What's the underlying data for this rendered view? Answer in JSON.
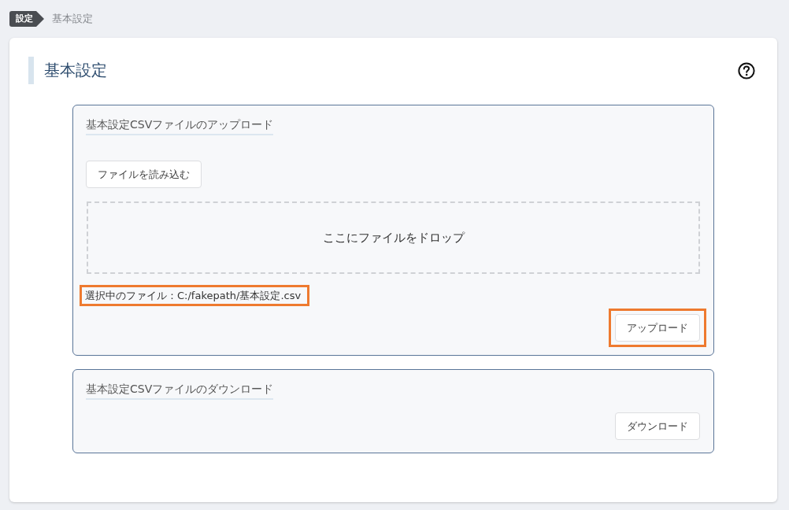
{
  "breadcrumb": [
    {
      "label": "設定",
      "kind": "tag"
    },
    {
      "label": "基本設定",
      "kind": "text"
    }
  ],
  "page": {
    "title": "基本設定"
  },
  "sections": [
    {
      "kind": "upload",
      "title": "基本設定CSVファイルのアップロード",
      "load_button": "ファイルを読み込む",
      "dropzone": "ここにファイルをドロップ",
      "selected_file": {
        "text": "選択中のファイル：C:/fakepath/基本設定.csv",
        "highlighted": true
      },
      "action": {
        "label": "アップロード",
        "highlighted": true
      }
    },
    {
      "kind": "download",
      "title": "基本設定CSVファイルのダウンロード",
      "action": {
        "label": "ダウンロード",
        "highlighted": false
      }
    }
  ]
}
